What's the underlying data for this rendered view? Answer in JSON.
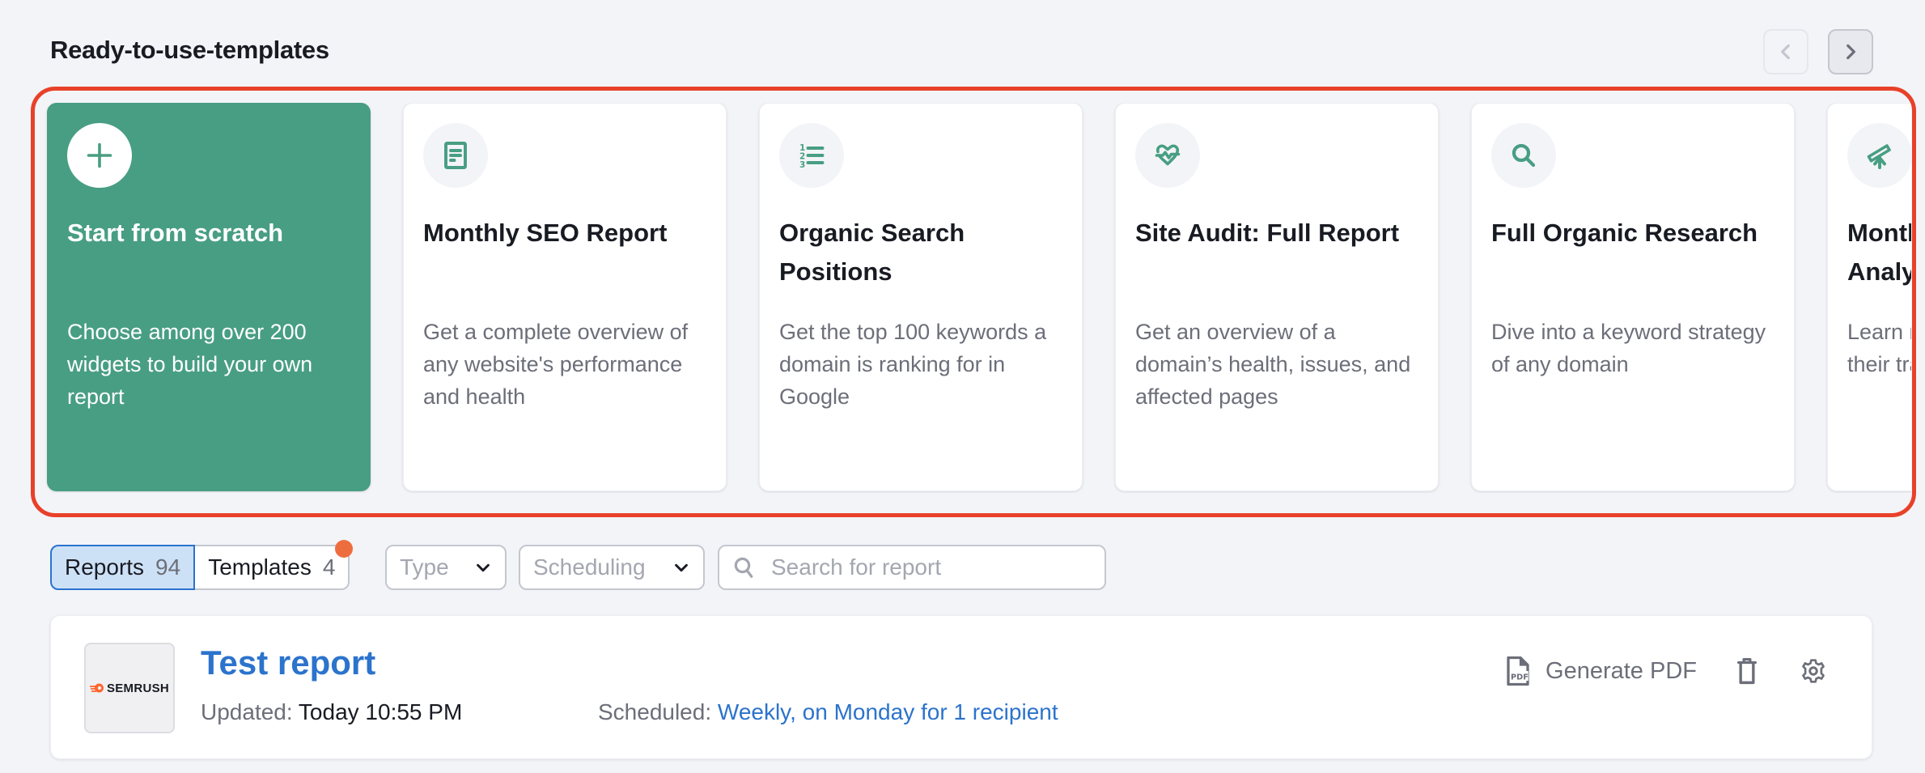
{
  "section": {
    "title": "Ready-to-use-templates",
    "nav": {
      "prev_icon": "chevron-left-icon",
      "next_icon": "chevron-right-icon"
    }
  },
  "templates": [
    {
      "title": "Start from scratch",
      "description": "Choose among over 200 widgets to build your own report",
      "icon": "plus-icon",
      "primary": true
    },
    {
      "title": "Monthly SEO Report",
      "description": "Get a complete overview of any website's performance and health",
      "icon": "document-icon"
    },
    {
      "title": "Organic Search Positions",
      "description": "Get the top 100 keywords a domain is ranking for in Google",
      "icon": "numbered-list-icon"
    },
    {
      "title": "Site Audit: Full Report",
      "description": "Get an overview of a domain’s health, issues, and affected pages",
      "icon": "heart-pulse-icon"
    },
    {
      "title": "Full Organic Research",
      "description": "Dive into a keyword strategy of any domain",
      "icon": "search-icon"
    },
    {
      "title": "Monthly Competitor Analysis",
      "description": "Learn more about your rivals: their traffic, content",
      "icon": "telescope-icon"
    }
  ],
  "filters": {
    "tabs": [
      {
        "label": "Reports",
        "count": "94",
        "active": true
      },
      {
        "label": "Templates",
        "count": "4",
        "has_notification": true
      }
    ],
    "type_dropdown": {
      "placeholder": "Type"
    },
    "scheduling_dropdown": {
      "placeholder": "Scheduling"
    },
    "search": {
      "placeholder": "Search for report",
      "value": ""
    }
  },
  "reports": [
    {
      "logo_text": "SEMRUSH",
      "title": "Test report",
      "updated_label": "Updated:",
      "updated_value": "Today 10:55 PM",
      "scheduled_label": "Scheduled:",
      "scheduled_value": "Weekly, on Monday for 1 recipient",
      "actions": {
        "pdf_label": "Generate PDF"
      }
    }
  ],
  "colors": {
    "accent_green": "#489e82",
    "link_blue": "#2b73cc",
    "highlight_red": "#e8412a",
    "notification_orange": "#ee6d3f",
    "page_bg": "#f3f4f8"
  }
}
